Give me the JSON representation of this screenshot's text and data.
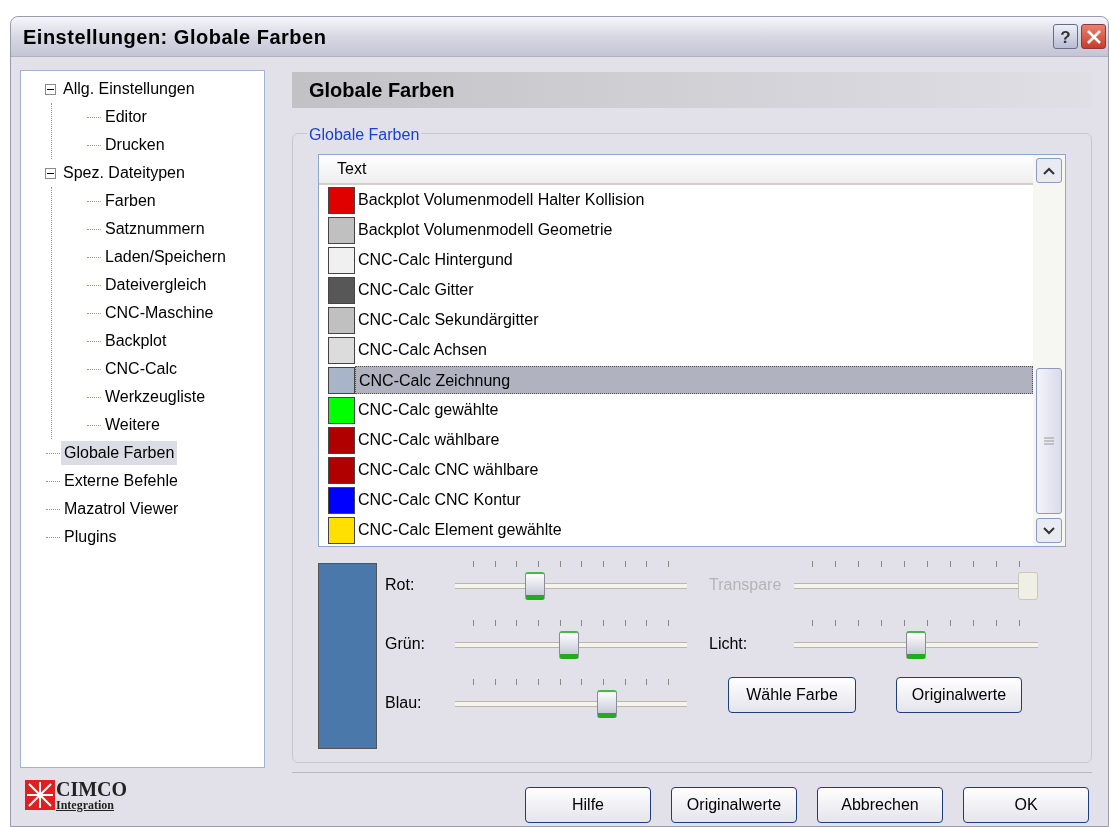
{
  "window": {
    "title": "Einstellungen: Globale Farben",
    "help_button": "?"
  },
  "tree": [
    {
      "label": "Allg. Einstellungen",
      "expanded": true,
      "selected": false,
      "children": [
        {
          "label": "Editor",
          "selected": false
        },
        {
          "label": "Drucken",
          "selected": false
        }
      ]
    },
    {
      "label": "Spez. Dateitypen",
      "expanded": true,
      "selected": false,
      "children": [
        {
          "label": "Farben",
          "selected": false
        },
        {
          "label": "Satznummern",
          "selected": false
        },
        {
          "label": "Laden/Speichern",
          "selected": false
        },
        {
          "label": "Dateivergleich",
          "selected": false
        },
        {
          "label": "CNC-Maschine",
          "selected": false
        },
        {
          "label": "Backplot",
          "selected": false
        },
        {
          "label": "CNC-Calc",
          "selected": false
        },
        {
          "label": "Werkzeugliste",
          "selected": false
        },
        {
          "label": "Weitere",
          "selected": false
        }
      ]
    },
    {
      "label": "Globale Farben",
      "selected": true
    },
    {
      "label": "Externe Befehle",
      "selected": false
    },
    {
      "label": "Mazatrol Viewer",
      "selected": false
    },
    {
      "label": "Plugins",
      "selected": false
    }
  ],
  "page_title": "Globale Farben",
  "group_title": "Globale Farben",
  "list": {
    "column": "Text",
    "items": [
      {
        "label": "Backplot Volumenmodell Halter Kollision",
        "color": "#e00000",
        "selected": false
      },
      {
        "label": "Backplot Volumenmodell Geometrie",
        "color": "#c0c0c0",
        "selected": false
      },
      {
        "label": "CNC-Calc Hintergund",
        "color": "#f0f0f0",
        "selected": false
      },
      {
        "label": "CNC-Calc Gitter",
        "color": "#575757",
        "selected": false
      },
      {
        "label": "CNC-Calc Sekundärgitter",
        "color": "#c0c0c0",
        "selected": false
      },
      {
        "label": "CNC-Calc Achsen",
        "color": "#dcdcdc",
        "selected": false
      },
      {
        "label": "CNC-Calc Zeichnung",
        "color": "#a8b4c8",
        "selected": true
      },
      {
        "label": "CNC-Calc gewählte",
        "color": "#00ff00",
        "selected": false
      },
      {
        "label": "CNC-Calc wählbare",
        "color": "#b00000",
        "selected": false
      },
      {
        "label": "CNC-Calc CNC wählbare",
        "color": "#b00000",
        "selected": false
      },
      {
        "label": "CNC-Calc CNC Kontur",
        "color": "#0000ff",
        "selected": false
      },
      {
        "label": "CNC-Calc Element gewählte",
        "color": "#ffe000",
        "selected": false
      }
    ]
  },
  "sliders_left": [
    {
      "label": "Rot:",
      "level": 0.33,
      "disabled": false
    },
    {
      "label": "Grün:",
      "level": 0.49,
      "disabled": false
    },
    {
      "label": "Blau:",
      "level": 0.67,
      "disabled": false
    }
  ],
  "sliders_right": [
    {
      "label": "Transpare",
      "level": 1.0,
      "disabled": true
    },
    {
      "label": "Licht:",
      "level": 0.5,
      "disabled": false
    }
  ],
  "panel_buttons": [
    "Wähle Farbe",
    "Originalwerte"
  ],
  "logo": {
    "name": "CIMCO",
    "subtitle": "Integration"
  },
  "buttons": [
    "Hilfe",
    "Originalwerte",
    "Abbrechen",
    "OK"
  ]
}
